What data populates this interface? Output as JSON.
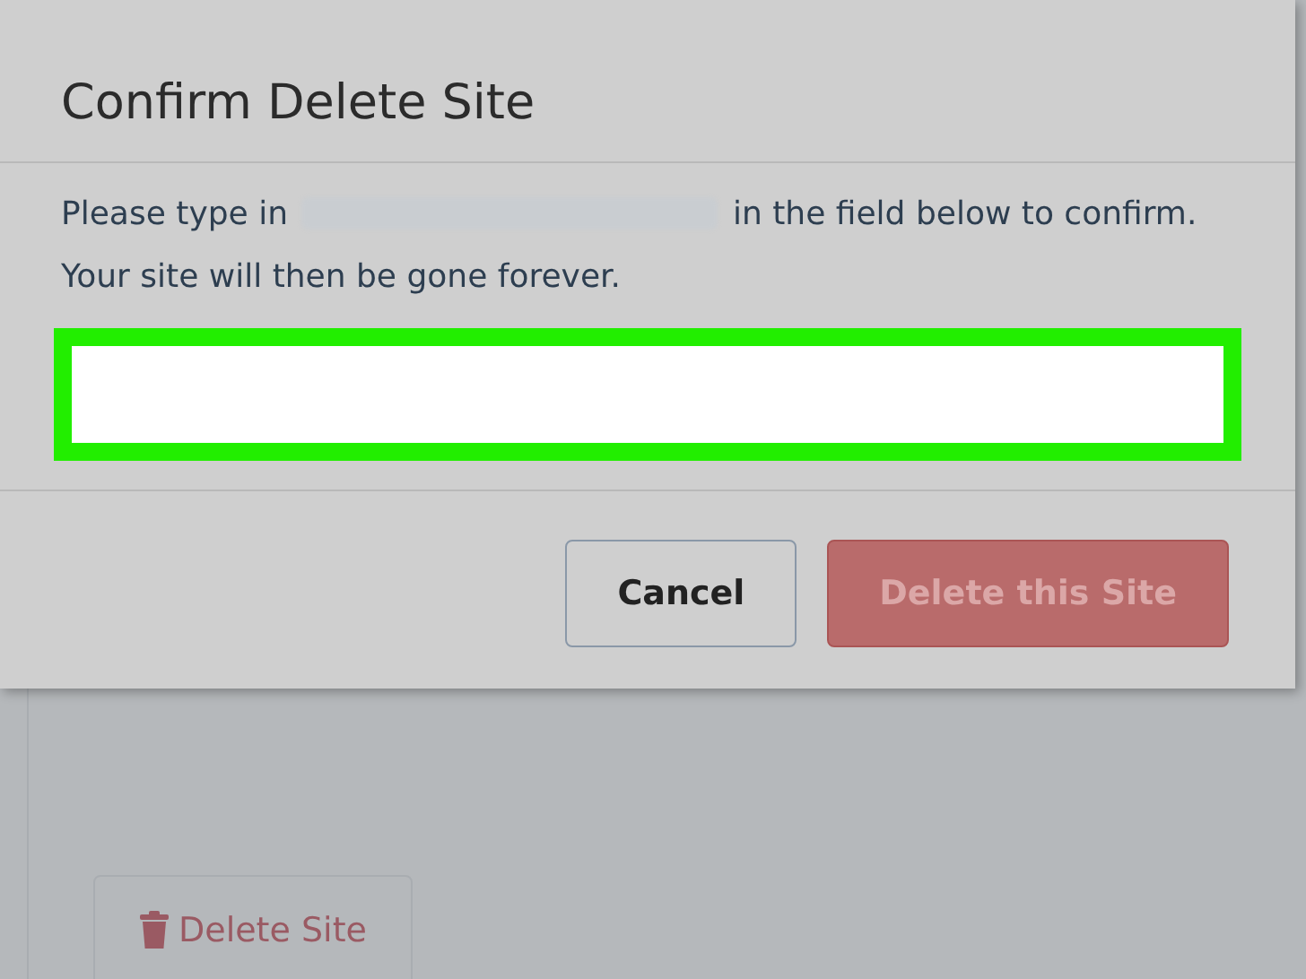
{
  "dialog": {
    "title": "Confirm Delete Site",
    "prompt_start": "Please type in",
    "site_name_redacted": true,
    "prompt_end": "in the field below to confirm.",
    "warning": "Your site will then be gone forever.",
    "confirm_field": {
      "highlighted": true
    },
    "buttons": [
      {
        "kind": "secondary",
        "label": "Cancel",
        "disabled": false
      },
      {
        "kind": "danger",
        "label": "Delete this Site",
        "disabled": true
      }
    ]
  },
  "page": {
    "delete_button": {
      "label": "Delete Site",
      "disabled": true
    }
  }
}
